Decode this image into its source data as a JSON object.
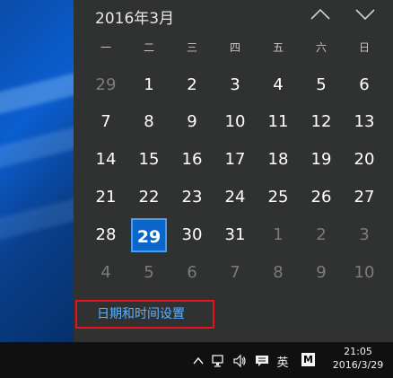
{
  "calendar": {
    "month_title": "2016年3月",
    "weekdays": [
      "一",
      "二",
      "三",
      "四",
      "五",
      "六",
      "日"
    ],
    "weeks": [
      [
        {
          "d": "29",
          "dim": true
        },
        {
          "d": "1"
        },
        {
          "d": "2"
        },
        {
          "d": "3"
        },
        {
          "d": "4"
        },
        {
          "d": "5"
        },
        {
          "d": "6"
        }
      ],
      [
        {
          "d": "7"
        },
        {
          "d": "8"
        },
        {
          "d": "9"
        },
        {
          "d": "10"
        },
        {
          "d": "11"
        },
        {
          "d": "12"
        },
        {
          "d": "13"
        }
      ],
      [
        {
          "d": "14"
        },
        {
          "d": "15"
        },
        {
          "d": "16"
        },
        {
          "d": "17"
        },
        {
          "d": "18"
        },
        {
          "d": "19"
        },
        {
          "d": "20"
        }
      ],
      [
        {
          "d": "21"
        },
        {
          "d": "22"
        },
        {
          "d": "23"
        },
        {
          "d": "24"
        },
        {
          "d": "25"
        },
        {
          "d": "26"
        },
        {
          "d": "27"
        }
      ],
      [
        {
          "d": "28"
        },
        {
          "d": "29",
          "today": true
        },
        {
          "d": "30"
        },
        {
          "d": "31"
        },
        {
          "d": "1",
          "dim": true
        },
        {
          "d": "2",
          "dim": true
        },
        {
          "d": "3",
          "dim": true
        }
      ],
      [
        {
          "d": "4",
          "dim": true
        },
        {
          "d": "5",
          "dim": true
        },
        {
          "d": "6",
          "dim": true
        },
        {
          "d": "7",
          "dim": true
        },
        {
          "d": "8",
          "dim": true
        },
        {
          "d": "9",
          "dim": true
        },
        {
          "d": "10",
          "dim": true
        }
      ]
    ],
    "prev_icon": "chevron-up-icon",
    "next_icon": "chevron-down-icon"
  },
  "settings_link": "日期和时间设置",
  "taskbar": {
    "ime_language": "英",
    "ime_mode": "M",
    "time": "21:05",
    "date": "2016/3/29"
  },
  "colors": {
    "flyout_bg": "#303232",
    "today_bg": "#0a67c9",
    "link": "#5db2ff",
    "annotation_box": "#e6121d"
  }
}
